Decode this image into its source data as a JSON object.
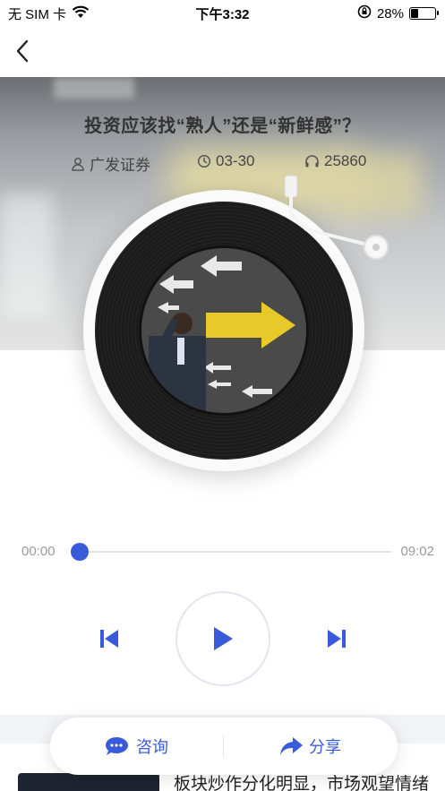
{
  "status_bar": {
    "carrier": "无 SIM 卡",
    "time": "下午3:32",
    "battery_percent": "28%",
    "battery_level": 0.28,
    "icons": [
      "wifi-icon",
      "orientation-lock-icon",
      "battery-icon"
    ]
  },
  "nav": {
    "back_icon": "chevron-left-icon"
  },
  "article": {
    "title": "投资应该找“熟人”还是“新鲜感”？",
    "author": "广发证券",
    "date": "03-30",
    "listens": "25860",
    "icons": {
      "author": "user-icon",
      "date": "clock-icon",
      "listens": "headphones-icon"
    }
  },
  "player": {
    "current_time": "00:00",
    "total_time": "09:02",
    "progress": 0.0,
    "accent_color": "#3a5bd9",
    "icons": {
      "prev": "skip-previous-icon",
      "play": "play-icon",
      "next": "skip-next-icon"
    }
  },
  "actions": {
    "consult_label": "咨询",
    "share_label": "分享",
    "icons": {
      "consult": "chat-bubble-icon",
      "share": "share-arrow-icon"
    }
  },
  "related": {
    "text": "板块炒作分化明显，市场观望情绪"
  }
}
